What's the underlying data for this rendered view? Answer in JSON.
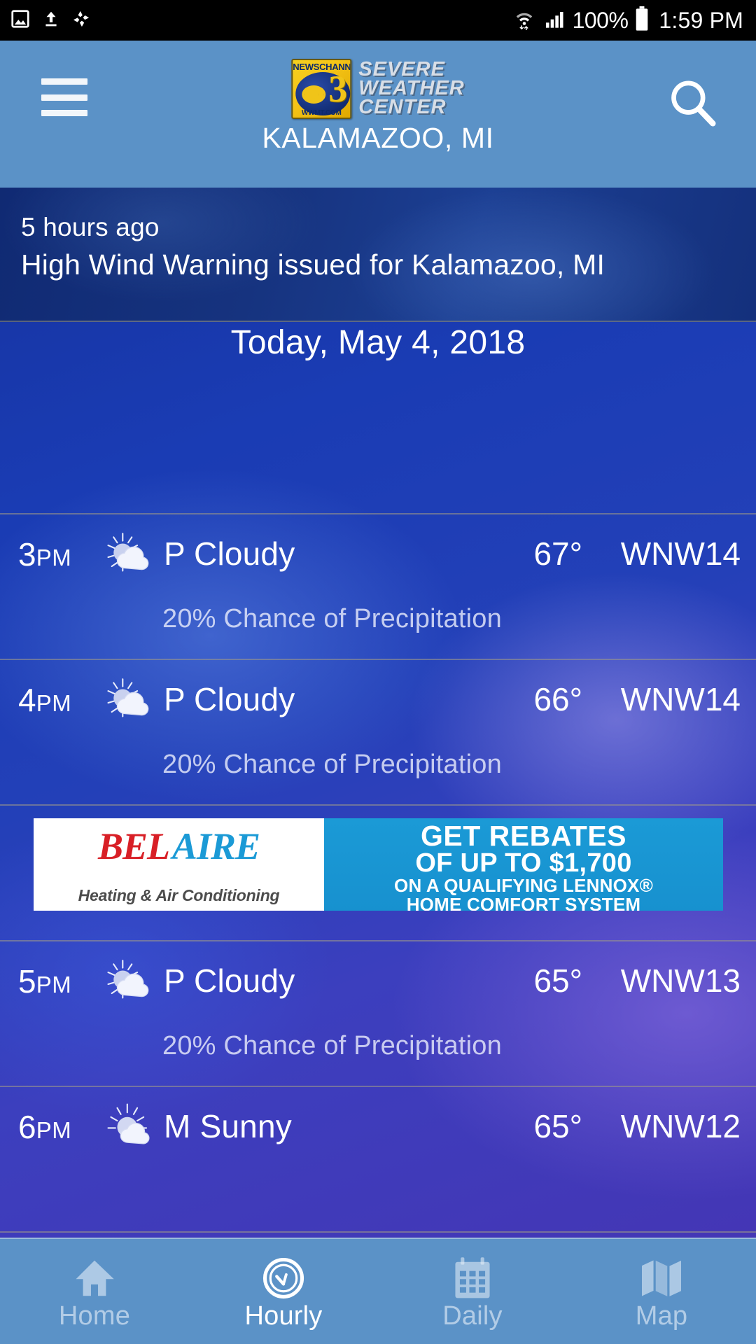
{
  "statusbar": {
    "icons_left": [
      "image-icon",
      "upload-icon",
      "sync-pinwheel-icon"
    ],
    "wifi_icon": "wifi-icon",
    "signal_icon": "cellular-signal-icon",
    "battery_percent": "100%",
    "battery_icon": "battery-full-icon",
    "time": "1:59 PM"
  },
  "header": {
    "menu_icon": "hamburger-menu-icon",
    "search_icon": "search-icon",
    "logo": {
      "badge_top": "NEWSCHANNEL",
      "badge_number": "3",
      "badge_bottom": "WWMT.COM",
      "line1": "SEVERE",
      "line2": "WEATHER",
      "line3": "CENTER"
    },
    "location": "KALAMAZOO, MI",
    "bg_color": "#5b92c7"
  },
  "alert": {
    "time_ago": "5 hours ago",
    "title": "High Wind Warning issued for Kalamazoo, MI"
  },
  "date_header": "Today, May 4, 2018",
  "hourly": [
    {
      "time": "3",
      "ampm": "PM",
      "icon": "partly-cloudy-icon",
      "condition": "P Cloudy",
      "temp": "67°",
      "wind": "WNW14",
      "precip": "20% Chance of Precipitation"
    },
    {
      "time": "4",
      "ampm": "PM",
      "icon": "partly-cloudy-icon",
      "condition": "P Cloudy",
      "temp": "66°",
      "wind": "WNW14",
      "precip": "20% Chance of Precipitation"
    },
    {
      "time": "5",
      "ampm": "PM",
      "icon": "partly-cloudy-icon",
      "condition": "P Cloudy",
      "temp": "65°",
      "wind": "WNW13",
      "precip": "20% Chance of Precipitation"
    },
    {
      "time": "6",
      "ampm": "PM",
      "icon": "mostly-sunny-icon",
      "condition": "M Sunny",
      "temp": "65°",
      "wind": "WNW12",
      "precip": ""
    }
  ],
  "ad": {
    "brand_part1": "BEL",
    "brand_part2": "AIRE",
    "tagline": "Heating & Air Conditioning",
    "line1": "GET REBATES",
    "line2": "OF UP TO $1,700",
    "line3": "ON A QUALIFYING LENNOX®",
    "line4": "HOME COMFORT SYSTEM"
  },
  "bottomnav": {
    "items": [
      {
        "label": "Home",
        "icon": "home-icon",
        "active": false
      },
      {
        "label": "Hourly",
        "icon": "clock-icon",
        "active": true
      },
      {
        "label": "Daily",
        "icon": "calendar-icon",
        "active": false
      },
      {
        "label": "Map",
        "icon": "map-icon",
        "active": false
      }
    ]
  }
}
